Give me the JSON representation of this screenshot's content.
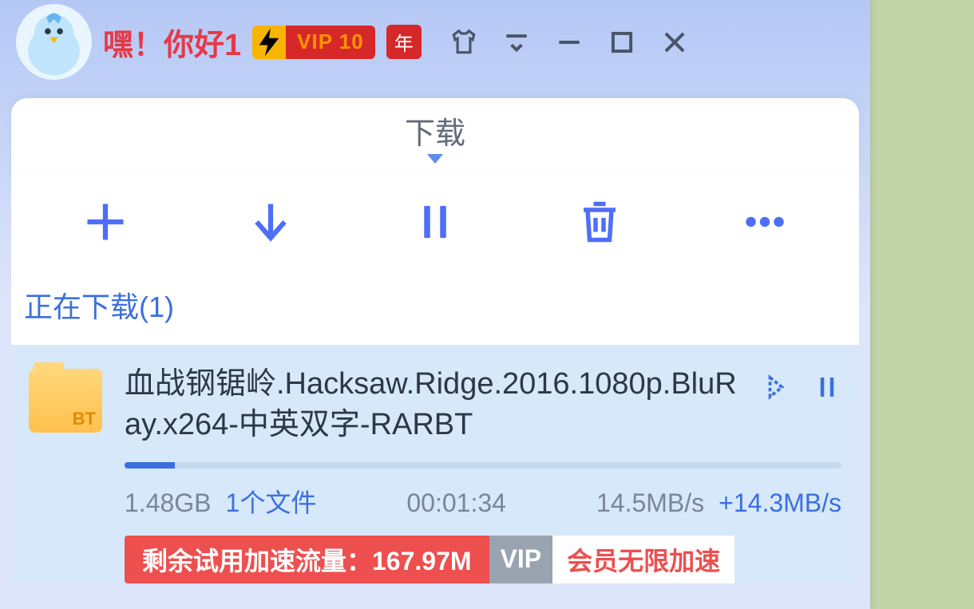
{
  "titlebar": {
    "greeting": "嘿！你好1",
    "vip_label": "VIP 10",
    "year_badge": "年"
  },
  "tab": {
    "label": "下载"
  },
  "section": {
    "downloading_label": "正在下载(1)"
  },
  "download": {
    "bt_tag": "BT",
    "title": "血战钢锯岭.Hacksaw.Ridge.2016.1080p.BluRay.x264-中英双字-RARBT",
    "progress_percent": 7,
    "size": "1.48GB",
    "file_count": "1个文件",
    "time_remaining": "00:01:34",
    "speed": "14.5MB/s",
    "accel_speed": "+14.3MB/s"
  },
  "promo": {
    "trial_text": "剩余试用加速流量：167.97M",
    "vip_label": "VIP",
    "unlimited_text": "会员无限加速"
  }
}
